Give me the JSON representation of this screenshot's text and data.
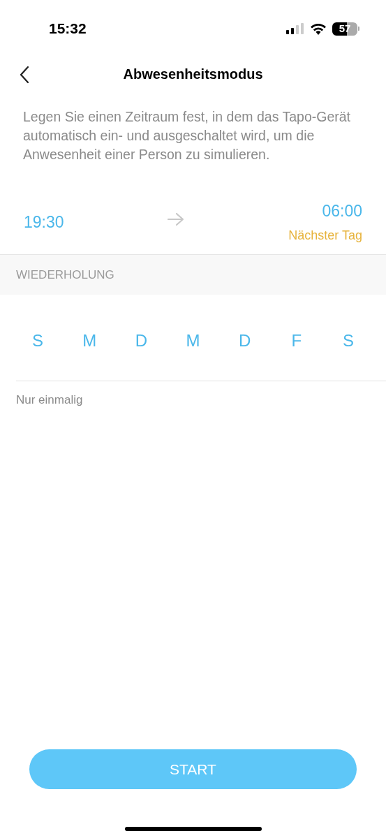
{
  "status_bar": {
    "time": "15:32",
    "battery": "57"
  },
  "header": {
    "title": "Abwesenheitsmodus"
  },
  "description": "Legen Sie einen Zeitraum fest, in dem das Tapo-Gerät automatisch ein- und ausgeschaltet wird, um die Anwesenheit einer Person zu simulieren.",
  "schedule": {
    "start": "19:30",
    "end": "06:00",
    "end_note": "Nächster Tag"
  },
  "repeat": {
    "heading": "WIEDERHOLUNG",
    "days": [
      {
        "label": "S",
        "selected": false
      },
      {
        "label": "M",
        "selected": false
      },
      {
        "label": "D",
        "selected": false
      },
      {
        "label": "M",
        "selected": false
      },
      {
        "label": "D",
        "selected": false
      },
      {
        "label": "F",
        "selected": false
      },
      {
        "label": "S",
        "selected": false
      }
    ],
    "summary": "Nur einmalig"
  },
  "start_button": "START"
}
